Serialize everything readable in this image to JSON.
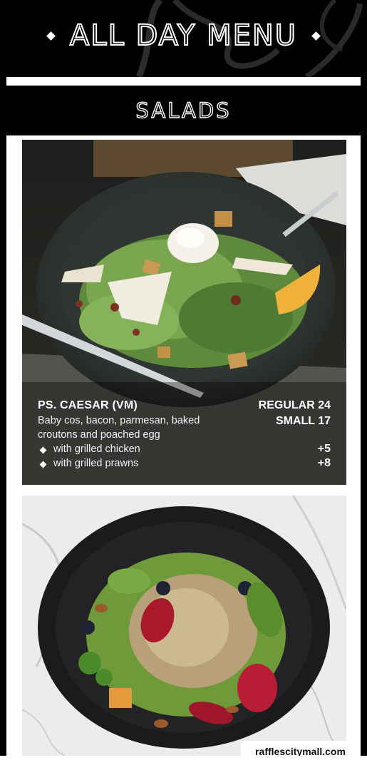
{
  "header": {
    "title": "ALL DAY MENU",
    "section": "SALADS"
  },
  "items": [
    {
      "name": "PS. CAESAR (VM)",
      "description": "Baby cos, bacon, parmesan, baked croutons and poached egg",
      "prices": [
        {
          "label": "REGULAR",
          "value": "24",
          "text": "REGULAR 24"
        },
        {
          "label": "SMALL",
          "value": "17",
          "text": "SMALL 17"
        }
      ],
      "addons": [
        {
          "label": "with grilled chicken",
          "price": "+5"
        },
        {
          "label": "with grilled prawns",
          "price": "+8"
        }
      ]
    }
  ],
  "watermark": "rafflescitymall.com",
  "colors": {
    "background": "#000000",
    "frame": "#ffffff",
    "text_on_photo": "#ffffff"
  },
  "icons": [
    "diamond-icon",
    "caesar-salad-photo",
    "grain-bowl-salad-photo"
  ]
}
